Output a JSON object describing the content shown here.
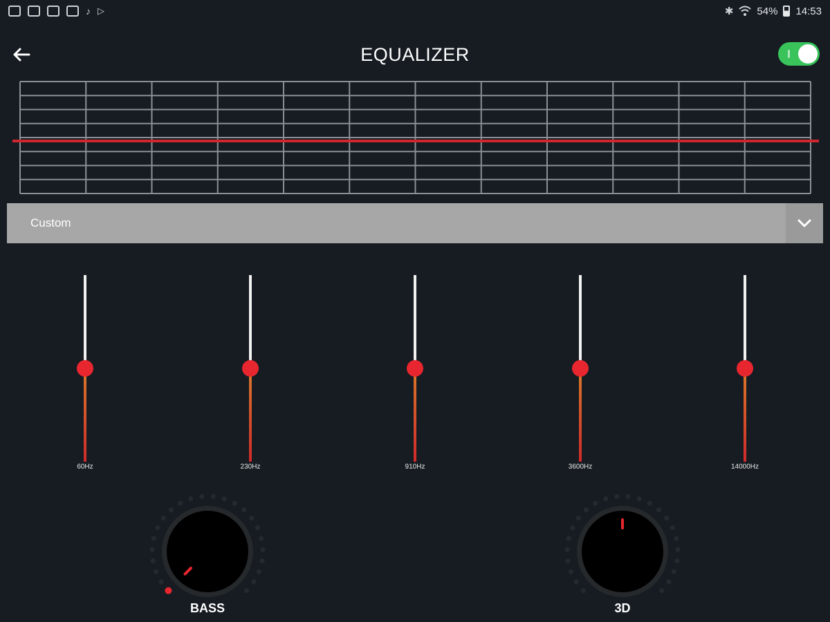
{
  "status_bar": {
    "left_icons": [
      "calendar-icon",
      "notification-icon",
      "gallery-icon",
      "tv-icon",
      "music-note-icon",
      "play-store-icon"
    ],
    "bluetooth_icon": "bluetooth-icon",
    "wifi_icon": "wifi-icon",
    "battery": "54%",
    "battery_level": 0.54,
    "time": "14:53"
  },
  "header": {
    "back_icon": "arrow-left-icon",
    "title": "EQUALIZER",
    "toggle_on": true,
    "toggle_color": "#39c35a"
  },
  "graph": {
    "line_color": "#d0262f",
    "grid_color": "#8b9096",
    "level": 0
  },
  "preset": {
    "selected": "Custom",
    "chevron_icon": "chevron-down-icon"
  },
  "bands": [
    {
      "freq": "60Hz",
      "level": 0.5
    },
    {
      "freq": "230Hz",
      "level": 0.5
    },
    {
      "freq": "910Hz",
      "level": 0.5
    },
    {
      "freq": "3600Hz",
      "level": 0.5
    },
    {
      "freq": "14000Hz",
      "level": 0.5
    }
  ],
  "knobs": [
    {
      "label": "BASS",
      "level": 0
    },
    {
      "label": "3D",
      "level": 0.5
    }
  ],
  "colors": {
    "background": "#161c22",
    "accent": "#e8262f"
  }
}
